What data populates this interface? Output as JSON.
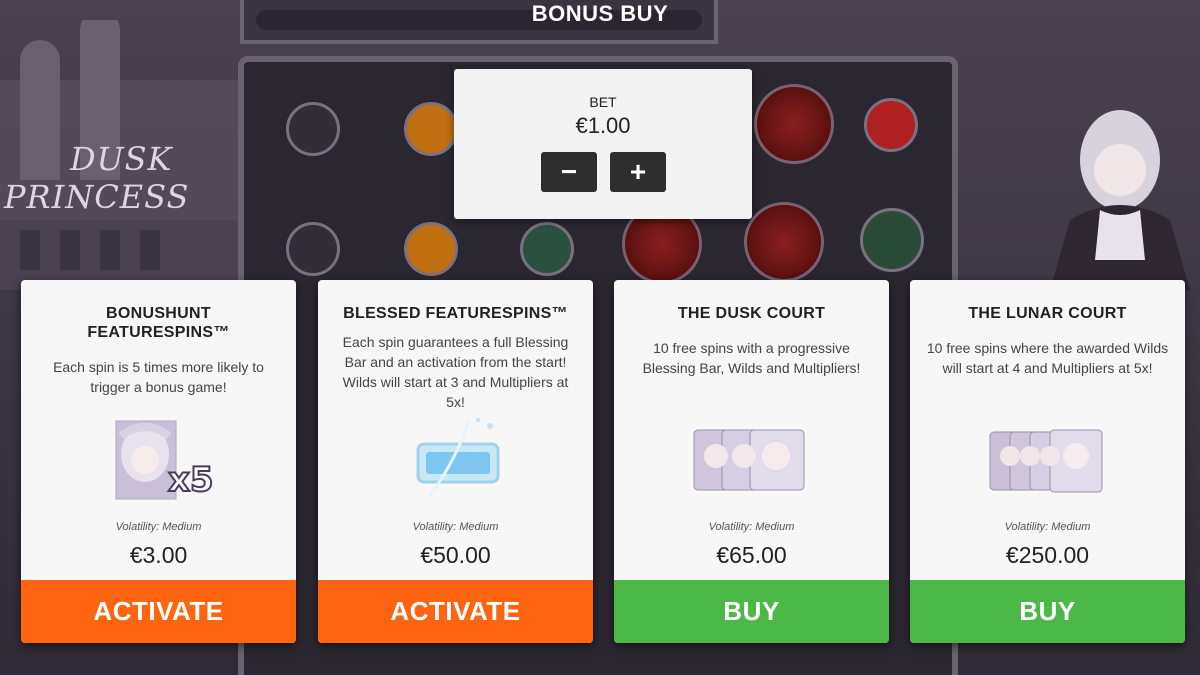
{
  "header": {
    "title": "BONUS BUY"
  },
  "game": {
    "logo_line1": "DUSK",
    "logo_line2": "PRINCESS"
  },
  "bet": {
    "label": "BET",
    "value": "€1.00",
    "minus_label": "−",
    "plus_label": "+"
  },
  "cards": [
    {
      "title": "BONUSHUNT\nFEATURESPINS™",
      "description": "Each spin is 5 times more likely to trigger a bonus game!",
      "image_badge": "x5",
      "volatility": "Volatility: Medium",
      "price": "€3.00",
      "button": "ACTIVATE",
      "button_color": "#ff6510"
    },
    {
      "title": "BLESSED FEATURESPINS™",
      "description": "Each spin guarantees a full Blessing Bar and an activation from the start! Wilds will start at 3 and Multipliers at 5x!",
      "volatility": "Volatility: Medium",
      "price": "€50.00",
      "button": "ACTIVATE",
      "button_color": "#ff6510"
    },
    {
      "title": "THE DUSK COURT",
      "description": "10 free spins with a progressive Blessing Bar, Wilds and Multipliers!",
      "volatility": "Volatility: Medium",
      "price": "€65.00",
      "button": "BUY",
      "button_color": "#4cb848"
    },
    {
      "title": "THE LUNAR COURT",
      "description": "10 free spins where the awarded Wilds will start at 4 and Multipliers at 5x!",
      "volatility": "Volatility: Medium",
      "price": "€250.00",
      "button": "BUY",
      "button_color": "#4cb848"
    }
  ]
}
